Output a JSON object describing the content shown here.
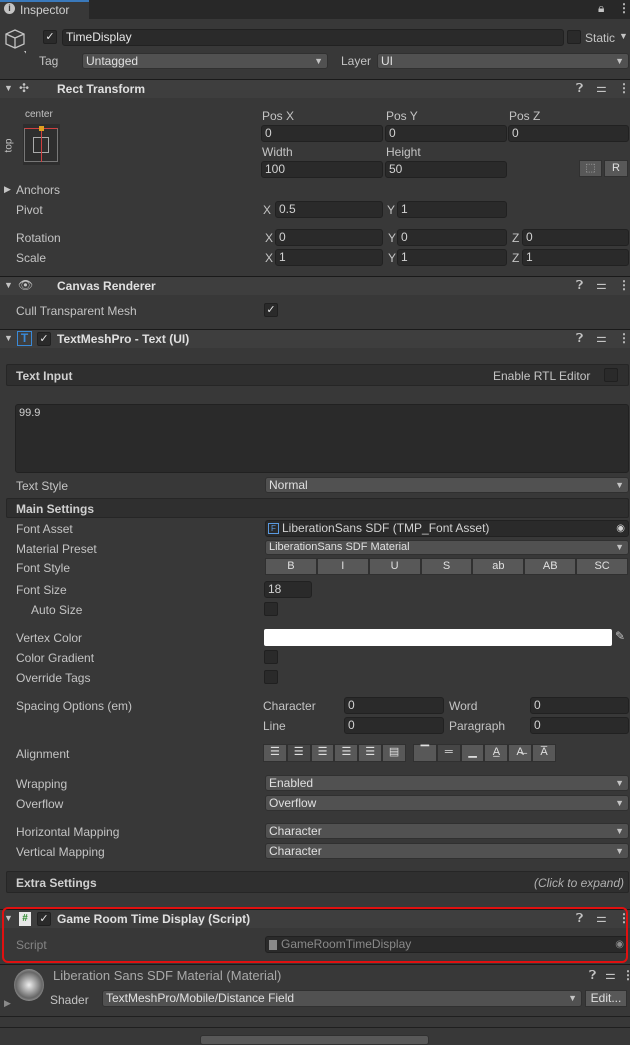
{
  "tab": {
    "title": "Inspector"
  },
  "object": {
    "name": "TimeDisplay",
    "active": true,
    "static_label": "Static",
    "tag_label": "Tag",
    "tag": "Untagged",
    "layer_label": "Layer",
    "layer": "UI"
  },
  "rect_transform": {
    "title": "Rect Transform",
    "anchor_h": "center",
    "anchor_v": "top",
    "pos_x_label": "Pos X",
    "pos_y_label": "Pos Y",
    "pos_z_label": "Pos Z",
    "pos_x": "0",
    "pos_y": "0",
    "pos_z": "0",
    "width_label": "Width",
    "height_label": "Height",
    "width": "100",
    "height": "50",
    "raw_btn": "R",
    "anchors_label": "Anchors",
    "pivot_label": "Pivot",
    "pivot_x": "0.5",
    "pivot_y": "1",
    "rotation_label": "Rotation",
    "rot_x": "0",
    "rot_y": "0",
    "rot_z": "0",
    "scale_label": "Scale",
    "scale_x": "1",
    "scale_y": "1",
    "scale_z": "1",
    "x": "X",
    "y": "Y",
    "z": "Z"
  },
  "canvas_renderer": {
    "title": "Canvas Renderer",
    "cull_label": "Cull Transparent Mesh",
    "cull": true
  },
  "tmp": {
    "title": "TextMeshPro - Text (UI)",
    "text_input_label": "Text Input",
    "rtl_label": "Enable RTL Editor",
    "text": "99.9",
    "text_style_label": "Text Style",
    "text_style": "Normal",
    "main_settings": "Main Settings",
    "font_asset_label": "Font Asset",
    "font_asset": "LiberationSans SDF (TMP_Font Asset)",
    "material_preset_label": "Material Preset",
    "material_preset": "LiberationSans SDF Material",
    "font_style_label": "Font Style",
    "font_styles": [
      "B",
      "I",
      "U",
      "S",
      "ab",
      "AB",
      "SC"
    ],
    "font_size_label": "Font Size",
    "font_size": "18",
    "auto_size_label": "Auto Size",
    "vertex_color_label": "Vertex Color",
    "vertex_color": "#ffffff",
    "color_gradient_label": "Color Gradient",
    "override_tags_label": "Override Tags",
    "spacing_label": "Spacing Options (em)",
    "character_label": "Character",
    "character": "0",
    "word_label": "Word",
    "word": "0",
    "line_label": "Line",
    "line": "0",
    "paragraph_label": "Paragraph",
    "paragraph": "0",
    "alignment_label": "Alignment",
    "wrapping_label": "Wrapping",
    "wrapping": "Enabled",
    "overflow_label": "Overflow",
    "overflow": "Overflow",
    "hmap_label": "Horizontal Mapping",
    "hmap": "Character",
    "vmap_label": "Vertical Mapping",
    "vmap": "Character",
    "extra_settings": "Extra Settings",
    "click_expand": "(Click to expand)"
  },
  "script_comp": {
    "title": "Game Room Time Display (Script)",
    "script_label": "Script",
    "script": "GameRoomTimeDisplay",
    "highlight_color": "#e01010"
  },
  "material": {
    "title": "Liberation Sans SDF Material (Material)",
    "shader_label": "Shader",
    "shader": "TextMeshPro/Mobile/Distance Field",
    "edit": "Edit..."
  }
}
